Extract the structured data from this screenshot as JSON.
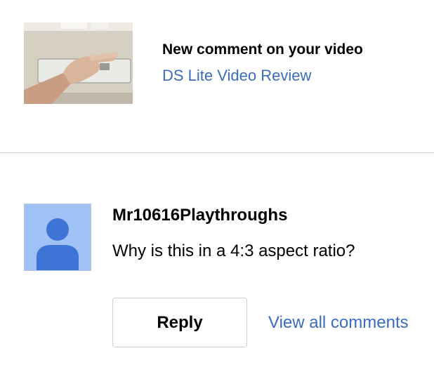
{
  "notification": {
    "title": "New comment on your video",
    "video_title": "DS Lite Video Review",
    "thumbnail_icon": "video-thumbnail-hand-ds-lite"
  },
  "comment": {
    "author": "Mr10616Playthroughs",
    "text": "Why is this in a 4:3 aspect ratio?",
    "avatar_icon": "default-user-avatar-icon"
  },
  "actions": {
    "reply_label": "Reply",
    "view_all_label": "View all comments"
  },
  "colors": {
    "link": "#3a6cc0",
    "avatar_bg": "#9fc1f5",
    "avatar_figure": "#3d74d6",
    "divider": "#cfcfcf"
  }
}
